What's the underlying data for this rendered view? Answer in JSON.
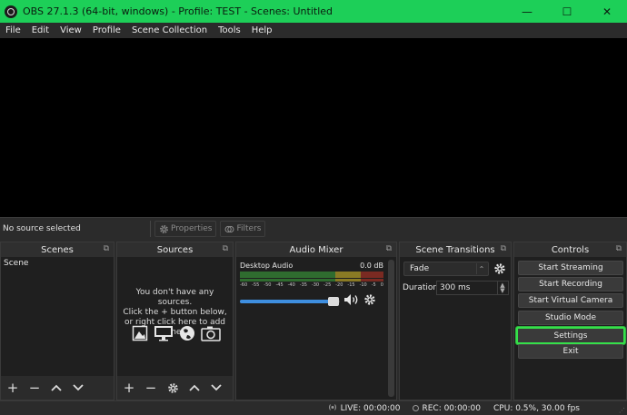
{
  "window": {
    "title": "OBS 27.1.3 (64-bit, windows) - Profile: TEST - Scenes: Untitled",
    "minimize_glyph": "—",
    "maximize_glyph": "☐",
    "close_glyph": "✕",
    "accent_color": "#1dcf58"
  },
  "menubar": {
    "items": [
      "File",
      "Edit",
      "View",
      "Profile",
      "Scene Collection",
      "Tools",
      "Help"
    ]
  },
  "source_toolbar": {
    "no_source_label": "No source selected",
    "properties_label": "Properties",
    "filters_label": "Filters"
  },
  "docks": {
    "scenes": {
      "title": "Scenes",
      "items": [
        "Scene"
      ],
      "footer_icons": [
        "add-icon",
        "remove-icon",
        "move-up-icon",
        "move-down-icon"
      ]
    },
    "sources": {
      "title": "Sources",
      "empty_line1": "You don't have any sources.",
      "empty_line2": "Click the + button below,",
      "empty_line3": "or right click here to add one.",
      "empty_icons": [
        "image-icon",
        "monitor-icon",
        "globe-icon",
        "camera-icon"
      ],
      "footer_icons": [
        "add-icon",
        "remove-icon",
        "gear-icon",
        "move-up-icon",
        "move-down-icon"
      ]
    },
    "mixer": {
      "title": "Audio Mixer",
      "track_name": "Desktop Audio",
      "level_text": "0.0 dB",
      "ticks": [
        "-60",
        "-55",
        "-50",
        "-45",
        "-40",
        "-35",
        "-30",
        "-25",
        "-20",
        "-15",
        "-10",
        "-5",
        "0"
      ],
      "volume_fraction": 0.94
    },
    "transitions": {
      "title": "Scene Transitions",
      "selected": "Fade",
      "duration_label": "Duration",
      "duration_value": "300 ms"
    },
    "controls": {
      "title": "Controls",
      "buttons": [
        "Start Streaming",
        "Start Recording",
        "Start Virtual Camera",
        "Studio Mode",
        "Settings",
        "Exit"
      ],
      "highlight_color": "#35e04a"
    }
  },
  "statusbar": {
    "live": "LIVE: 00:00:00",
    "rec": "REC: 00:00:00",
    "cpu": "CPU: 0.5%, 30.00 fps"
  }
}
